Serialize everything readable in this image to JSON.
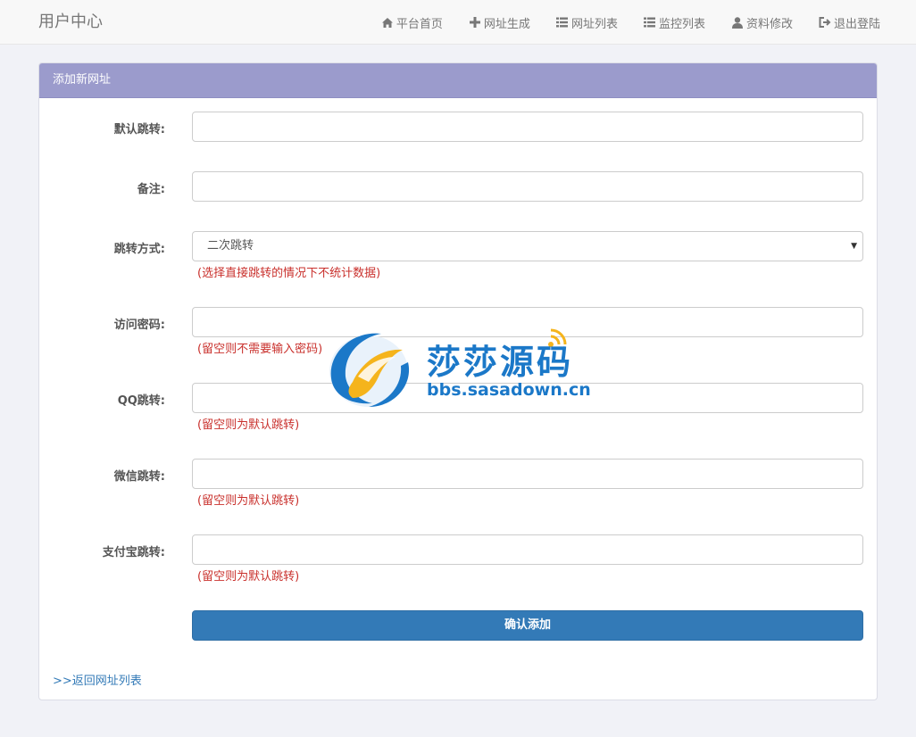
{
  "navbar": {
    "brand": "用户中心",
    "items": [
      {
        "label": "平台首页",
        "icon": "home-icon"
      },
      {
        "label": "网址生成",
        "icon": "plus-icon"
      },
      {
        "label": "网址列表",
        "icon": "list-icon"
      },
      {
        "label": "监控列表",
        "icon": "list-icon"
      },
      {
        "label": "资料修改",
        "icon": "user-icon"
      },
      {
        "label": "退出登陆",
        "icon": "logout-icon"
      }
    ]
  },
  "panel": {
    "title": "添加新网址"
  },
  "form": {
    "default_redirect": {
      "label": "默认跳转:",
      "value": ""
    },
    "remark": {
      "label": "备注:",
      "value": ""
    },
    "redirect_mode": {
      "label": "跳转方式:",
      "selected": "二次跳转",
      "help": "(选择直接跳转的情况下不统计数据)"
    },
    "access_password": {
      "label": "访问密码:",
      "value": "",
      "help": "(留空则不需要输入密码)"
    },
    "qq_redirect": {
      "label": "QQ跳转:",
      "value": "",
      "help": "(留空则为默认跳转)"
    },
    "wechat_redirect": {
      "label": "微信跳转:",
      "value": "",
      "help": "(留空则为默认跳转)"
    },
    "alipay_redirect": {
      "label": "支付宝跳转:",
      "value": "",
      "help": "(留空则为默认跳转)"
    },
    "submit_label": "确认添加",
    "back_link": ">>返回网址列表"
  },
  "watermark": {
    "title": "莎莎源码",
    "url": "bbs.sasadown.cn"
  },
  "colors": {
    "panel_heading": "#9b9bcc",
    "primary": "#337ab7",
    "help_text": "#c9302c",
    "watermark": "#1b78c8"
  }
}
